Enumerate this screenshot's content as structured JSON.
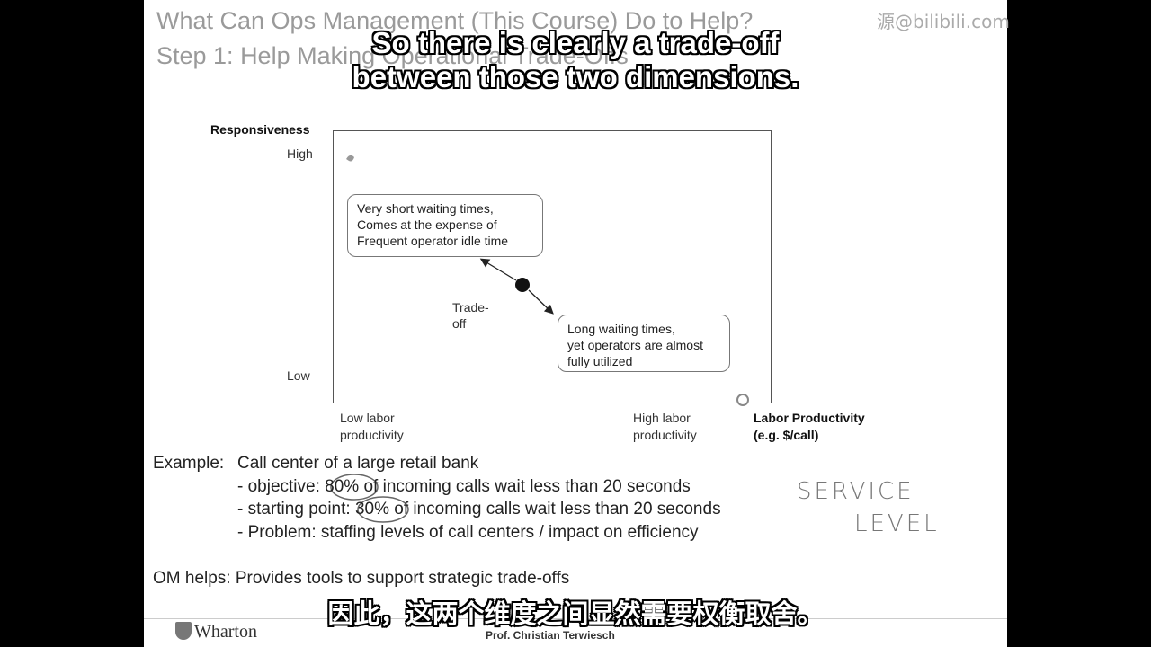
{
  "slide": {
    "title_line1": "What Can Ops Management (This Course) Do to Help?",
    "title_line2": "Step 1: Help Making Operational Trade-Offs"
  },
  "watermark": "源@bilibili.com",
  "subtitles": {
    "en_line1": "So there is clearly a trade-off",
    "en_line2": "between those two dimensions.",
    "zh": "因此，这两个维度之间显然需要权衡取舍。"
  },
  "diagram": {
    "y_axis_title": "Responsiveness",
    "y_high": "High",
    "y_low": "Low",
    "x_low_line1": "Low labor",
    "x_low_line2": "productivity",
    "x_high_line1": "High labor",
    "x_high_line2": "productivity",
    "x_axis_title_line1": "Labor Productivity",
    "x_axis_title_line2": "(e.g. $/call)",
    "callout_top": [
      "Very short waiting times,",
      "Comes at the expense of",
      "Frequent operator idle time"
    ],
    "callout_bottom": [
      "Long waiting times,",
      "yet operators are almost",
      "fully utilized"
    ],
    "tradeoff_line1": "Trade-",
    "tradeoff_line2": "off"
  },
  "example": {
    "label": "Example:",
    "heading": "Call center of a large retail bank",
    "objective_prefix": "- objective:",
    "objective_value": "80%",
    "objective_suffix": "of incoming calls wait less than 20 seconds",
    "start_prefix": "- starting point:",
    "start_value": "30%",
    "start_suffix": "of incoming calls wait less than 20 seconds",
    "problem": "- Problem: staffing levels of call centers / impact on efficiency",
    "om_helps": "OM helps: Provides tools to support strategic trade-offs"
  },
  "handwriting": {
    "line1": "SERVICE",
    "line2": "LEVEL"
  },
  "footer": {
    "logo": "Wharton",
    "presenter": "Prof. Christian Terwiesch"
  }
}
